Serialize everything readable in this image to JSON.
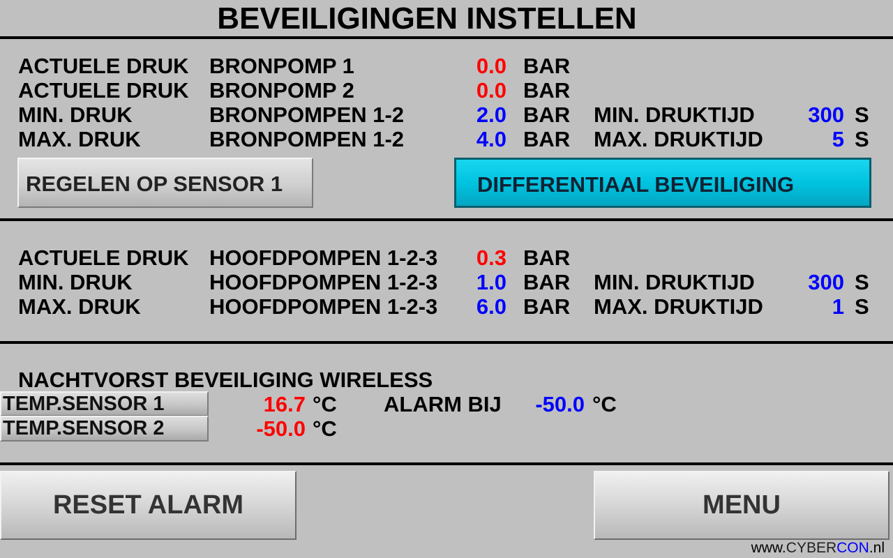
{
  "title": "BEVEILIGINGEN INSTELLEN",
  "bronpompen": {
    "rows": [
      {
        "c1": "ACTUELE DRUK",
        "c2": "BRONPOMP 1",
        "value": "0.0",
        "unit": "BAR",
        "extra_label": "",
        "extra_value": "",
        "extra_unit": ""
      },
      {
        "c1": "ACTUELE DRUK",
        "c2": "BRONPOMP 2",
        "value": "0.0",
        "unit": "BAR",
        "extra_label": "",
        "extra_value": "",
        "extra_unit": ""
      },
      {
        "c1": "MIN.   DRUK",
        "c2": "BRONPOMPEN 1-2",
        "value": "2.0",
        "unit": "BAR",
        "extra_label": "MIN.  DRUKTIJD",
        "extra_value": "300",
        "extra_unit": "S"
      },
      {
        "c1": "MAX.  DRUK",
        "c2": "BRONPOMPEN 1-2",
        "value": "4.0",
        "unit": "BAR",
        "extra_label": "MAX. DRUKTIJD",
        "extra_value": "5",
        "extra_unit": "S"
      }
    ],
    "regelen_button": "REGELEN OP SENSOR 1",
    "differentiaal_button": "DIFFERENTIAAL BEVEILIGING"
  },
  "hoofdpompen": {
    "rows": [
      {
        "c1": "ACTUELE DRUK",
        "c2": "HOOFDPOMPEN 1-2-3",
        "value": "0.3",
        "unit": "BAR",
        "extra_label": "",
        "extra_value": "",
        "extra_unit": ""
      },
      {
        "c1": "MIN.   DRUK",
        "c2": "HOOFDPOMPEN 1-2-3",
        "value": "1.0",
        "unit": "BAR",
        "extra_label": "MIN.  DRUKTIJD",
        "extra_value": "300",
        "extra_unit": "S"
      },
      {
        "c1": "MAX.  DRUK",
        "c2": "HOOFDPOMPEN 1-2-3",
        "value": "6.0",
        "unit": "BAR",
        "extra_label": "MAX. DRUKTIJD",
        "extra_value": "1",
        "extra_unit": "S"
      }
    ]
  },
  "nachtvorst": {
    "title": "NACHTVORST BEVEILIGING WIRELESS",
    "sensor1_label": "TEMP.SENSOR 1",
    "sensor1_value": "16.7",
    "sensor1_unit": "°C",
    "sensor2_label": "TEMP.SENSOR 2",
    "sensor2_value": "-50.0",
    "sensor2_unit": "°C",
    "alarm_label": "ALARM BIJ",
    "alarm_value": "-50.0",
    "alarm_unit": "°C"
  },
  "buttons": {
    "reset": "RESET ALARM",
    "menu": "MENU"
  },
  "footer": {
    "prefix": "www.",
    "brand1": "CYBER",
    "brand2": "CON",
    "suffix": ".nl"
  },
  "colors": {
    "background": "#c0c0c0",
    "actual_value": "#ff0000",
    "setpoint_value": "#0000ff",
    "differential_button": "#00c3e0"
  }
}
